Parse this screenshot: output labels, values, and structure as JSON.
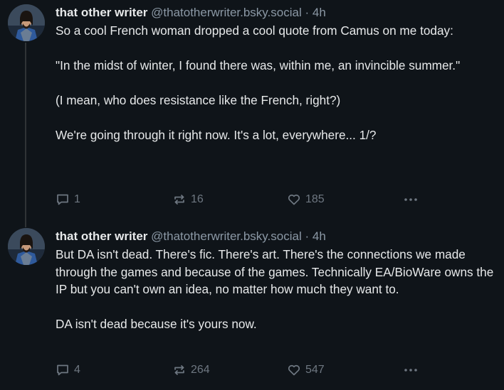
{
  "posts": [
    {
      "author": "that other writer",
      "handle": "@thatotherwriter.bsky.social",
      "dot": "·",
      "time": "4h",
      "paragraphs": [
        "So a cool French woman dropped a cool quote from Camus on me today:",
        "\"In the midst of winter, I found there was, within me, an invincible summer.\"",
        "(I mean, who does resistance like the French, right?)",
        "We're going through it right now. It's a lot, everywhere... 1/?"
      ],
      "replies": "1",
      "reposts": "16",
      "likes": "185"
    },
    {
      "author": "that other writer",
      "handle": "@thatotherwriter.bsky.social",
      "dot": "·",
      "time": "4h",
      "paragraphs": [
        "But DA isn't dead. There's fic. There's art. There's the connections we made through the games and because of the games. Technically EA/BioWare owns the IP but you can't own an idea, no matter how much they want to.",
        "DA isn't dead because it's  yours now."
      ],
      "replies": "4",
      "reposts": "264",
      "likes": "547"
    }
  ],
  "icons": {
    "reply": "speech-bubble",
    "repost": "repost-arrows",
    "like": "heart",
    "more": "ellipsis"
  },
  "colors": {
    "background": "#0f1419",
    "text": "#e7e9ea",
    "secondary": "#8b98a5",
    "action": "#6e7781"
  }
}
